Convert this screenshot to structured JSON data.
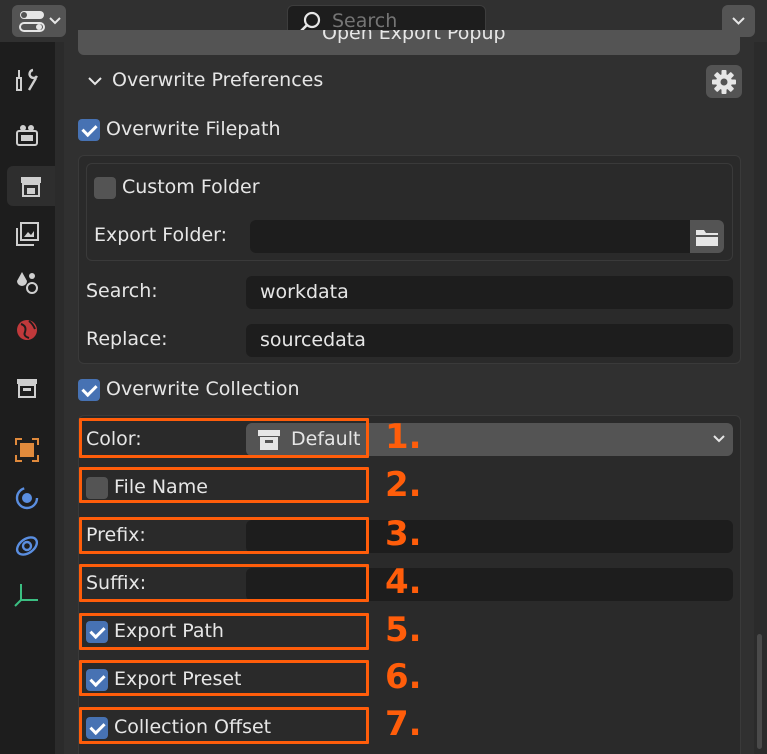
{
  "header": {
    "search_placeholder": "Search"
  },
  "sidebar": {
    "icons": [
      "tool-icon",
      "render-icon",
      "output-icon",
      "view-layer-icon",
      "scene-icon",
      "world-icon",
      "collection-icon",
      "object-icon",
      "physics-icon",
      "constraints-icon",
      "data-icon"
    ]
  },
  "panel": {
    "export_button_label": "Open Export Popup",
    "title": "Overwrite Preferences",
    "overwrite_filepath": {
      "label": "Overwrite Filepath",
      "checked": true
    },
    "custom_folder": {
      "label": "Custom Folder",
      "checked": false
    },
    "export_folder": {
      "label": "Export Folder:",
      "value": ""
    },
    "search": {
      "label": "Search:",
      "value": "workdata"
    },
    "replace": {
      "label": "Replace:",
      "value": "sourcedata"
    },
    "overwrite_collection": {
      "label": "Overwrite Collection",
      "checked": true
    },
    "color": {
      "label": "Color:",
      "value": "Default"
    },
    "file_name": {
      "label": "File Name",
      "checked": false
    },
    "prefix": {
      "label": "Prefix:",
      "value": ""
    },
    "suffix": {
      "label": "Suffix:",
      "value": ""
    },
    "export_path": {
      "label": "Export Path",
      "checked": true
    },
    "export_preset": {
      "label": "Export Preset",
      "checked": true
    },
    "collection_offset": {
      "label": "Collection Offset",
      "checked": true
    }
  },
  "annotations": [
    "1.",
    "2.",
    "3.",
    "4.",
    "5.",
    "6.",
    "7."
  ],
  "colors": {
    "accent": "#4772b3",
    "annotation": "#ff5d0a"
  }
}
